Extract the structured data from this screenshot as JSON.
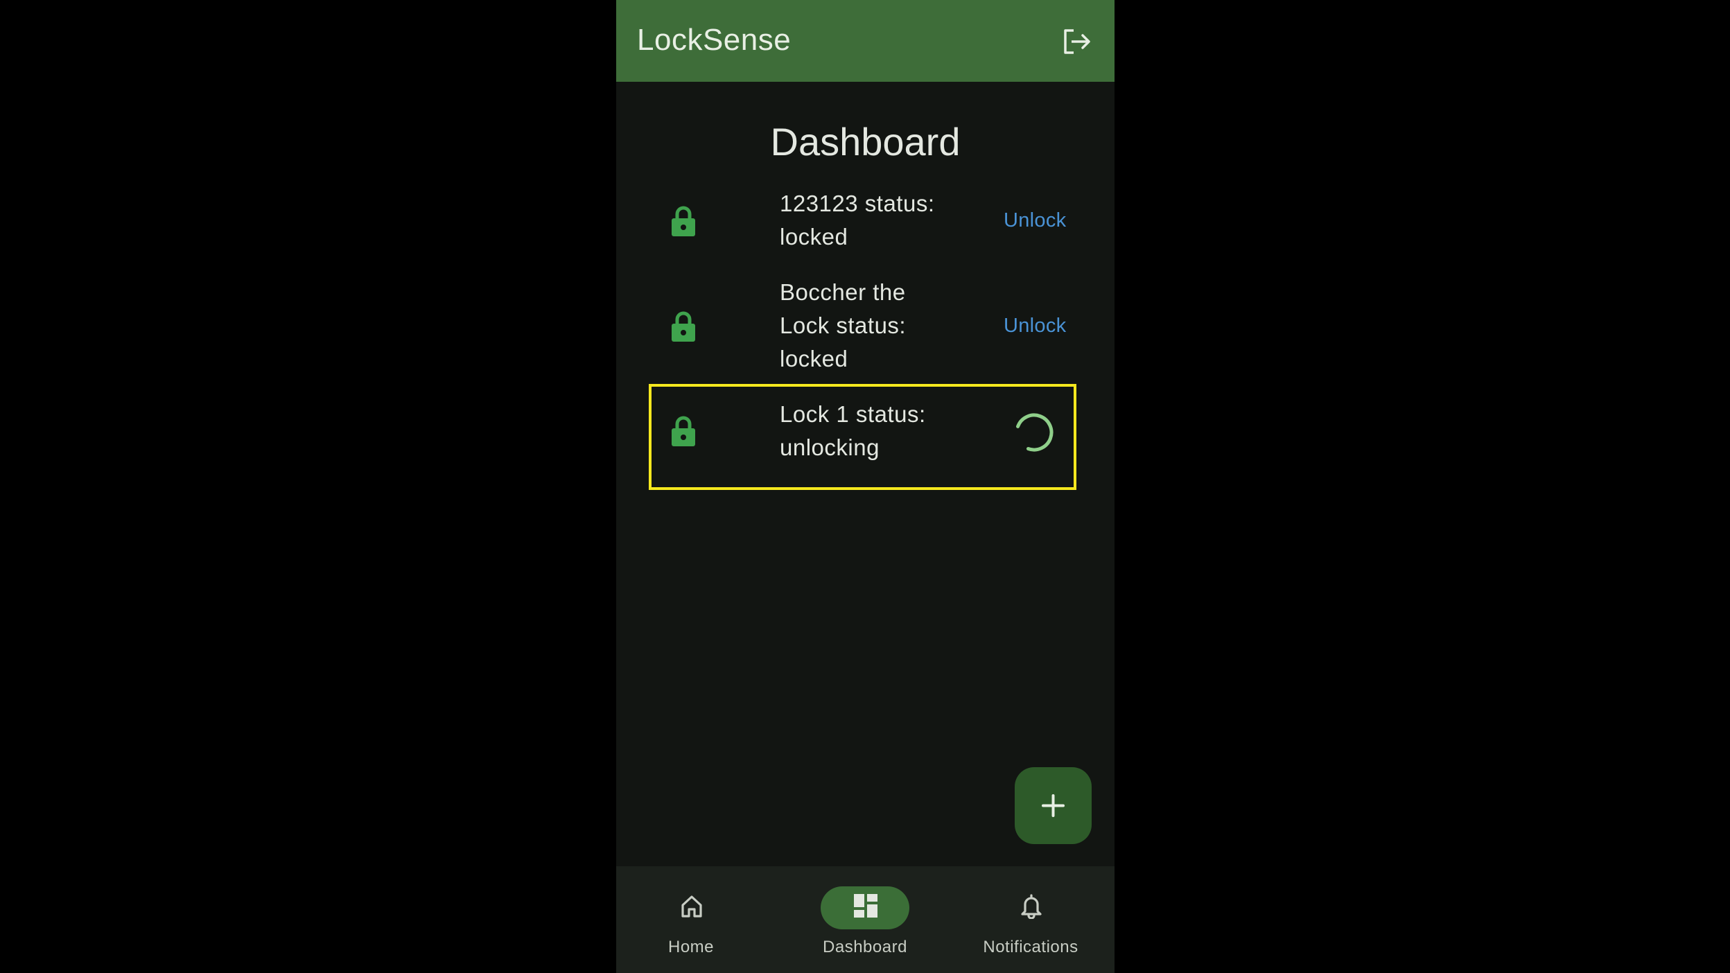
{
  "app": {
    "title": "LockSense",
    "accent_color": "#3e6d39"
  },
  "header": {
    "logout_icon": "logout-icon"
  },
  "main": {
    "title": "Dashboard",
    "locks": [
      {
        "text": "123123 status: locked",
        "line1": "123123 status:",
        "line2": "locked",
        "action": "Unlock",
        "icon": "lock-icon"
      },
      {
        "text": "Boccher the Lock status: locked",
        "line1": "Boccher the",
        "line2": "Lock status:",
        "line3": "locked",
        "action": "Unlock",
        "icon": "lock-icon"
      },
      {
        "text": "Lock 1 status: unlocking",
        "line1": "Lock 1 status:",
        "line2": "unlocking",
        "action_icon": "loading-spinner",
        "icon": "lock-icon"
      }
    ]
  },
  "fab": {
    "icon": "plus-icon"
  },
  "bottom_nav": {
    "items": [
      {
        "label": "Home",
        "icon": "home-icon",
        "selected": false
      },
      {
        "label": "Dashboard",
        "icon": "dashboard-icon",
        "selected": true
      },
      {
        "label": "Notifications",
        "icon": "bell-icon",
        "selected": false
      }
    ]
  }
}
